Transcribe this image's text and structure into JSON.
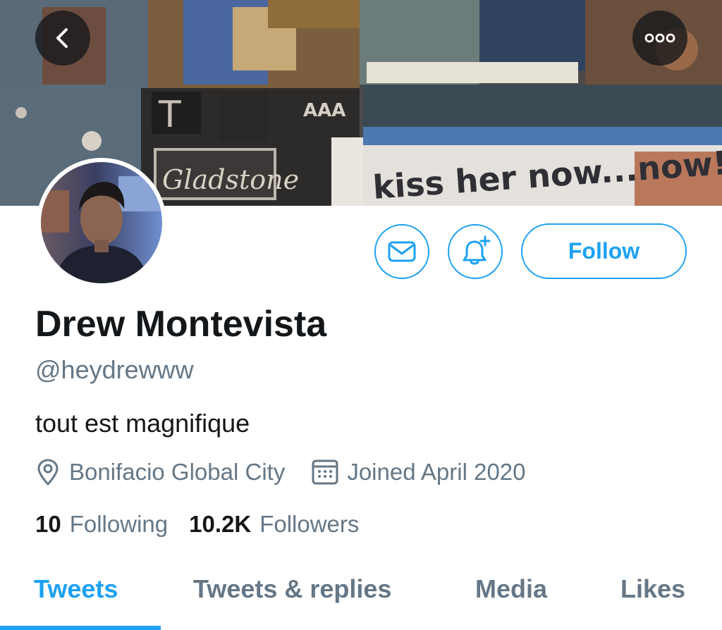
{
  "banner": {
    "signs": {
      "theater_sign": "Gladstone",
      "sign_letters": "T",
      "billboard": "kiss her now...now!",
      "aaa": "AAA"
    }
  },
  "actions": {
    "follow_label": "Follow"
  },
  "profile": {
    "name": "Drew Montevista",
    "handle": "@heydrewww",
    "bio": "tout est magnifique",
    "location": "Bonifacio Global City",
    "joined": "Joined April 2020"
  },
  "stats": {
    "following_count": "10",
    "following_label": "Following",
    "followers_count": "10.2K",
    "followers_label": "Followers"
  },
  "tabs": [
    {
      "label": "Tweets",
      "active": true
    },
    {
      "label": "Tweets & replies",
      "active": false
    },
    {
      "label": "Media",
      "active": false
    },
    {
      "label": "Likes",
      "active": false
    }
  ],
  "colors": {
    "accent": "#1da1f2",
    "text_primary": "#14171a",
    "text_secondary": "#657786"
  },
  "icons": [
    "chevron-left-icon",
    "more-icon",
    "mail-icon",
    "bell-plus-icon",
    "location-pin-icon",
    "calendar-icon"
  ]
}
